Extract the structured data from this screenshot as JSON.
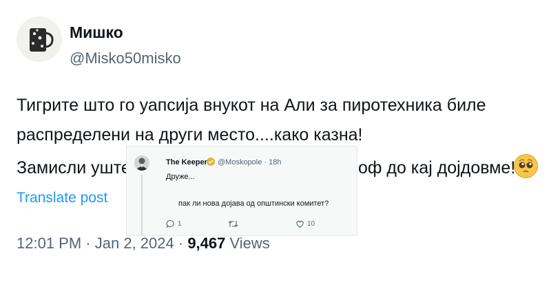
{
  "tweet": {
    "author_name": "Мишко",
    "author_handle": "@Misko50misko",
    "avatar_icon": "mug-avatar-icon",
    "body_line1": "Тигрите што го уапсија внукот на Али за пиротехника биле",
    "body_line2": "распределени на други место....како казна!",
    "body_line3_start": "Замисли уште",
    "body_line3_end": ".оф до кај дојдовме!",
    "emoji_icon": "pleading-face-emoji-icon",
    "translate_label": "Translate post",
    "time": "12:01 PM",
    "separator": "·",
    "date": "Jan 2, 2024",
    "views_count": "9,467",
    "views_label": "Views"
  },
  "reply_card": {
    "author_name": "The Keeper",
    "badge_icon": "verified-badge-icon",
    "author_handle": "@Moskopole · 18h",
    "text_line1": "Друже...",
    "text_line2": "пак ли нова дојава од општински комитет?",
    "actions": {
      "reply_count": "1",
      "retweet_count": "",
      "like_count": "10"
    }
  },
  "colors": {
    "text": "#0f1419",
    "secondary": "#536471",
    "link": "#1d9bf0",
    "card_bg": "#f7f9f9"
  }
}
